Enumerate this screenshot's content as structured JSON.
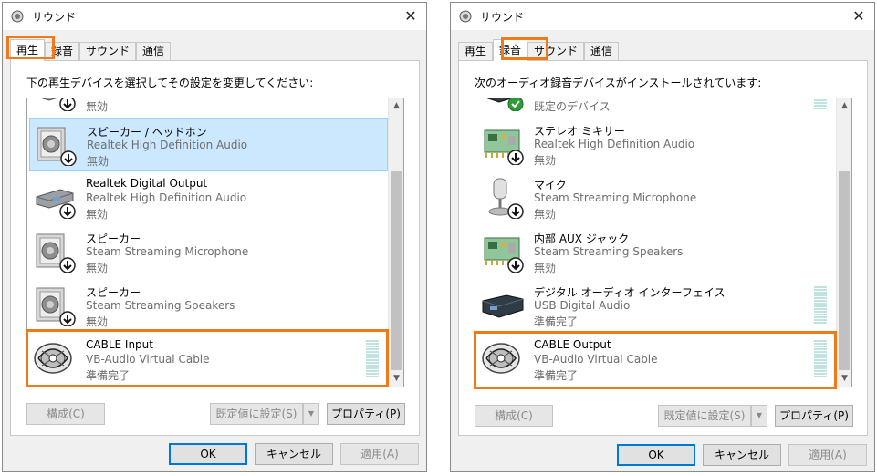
{
  "left": {
    "title": "サウンド",
    "tabs": [
      {
        "label": "再生"
      },
      {
        "label": "録音"
      },
      {
        "label": "サウンド"
      },
      {
        "label": "通信"
      }
    ],
    "instruction": "下の再生デバイスを選択してその設定を変更してください:",
    "devices": [
      {
        "status": "無効"
      },
      {
        "name": "スピーカー / ヘッドホン",
        "desc": "Realtek High Definition Audio",
        "status": "無効"
      },
      {
        "name": "Realtek Digital Output",
        "desc": "Realtek High Definition Audio",
        "status": "無効"
      },
      {
        "name": "スピーカー",
        "desc": "Steam Streaming Microphone",
        "status": "無効"
      },
      {
        "name": "スピーカー",
        "desc": "Steam Streaming Speakers",
        "status": "無効"
      },
      {
        "name": "CABLE Input",
        "desc": "VB-Audio Virtual Cable",
        "status": "準備完了"
      }
    ],
    "buttons": {
      "configure": "構成(C)",
      "set_default": "既定値に設定(S)",
      "properties": "プロパティ(P)",
      "ok": "OK",
      "cancel": "キャンセル",
      "apply": "適用(A)"
    }
  },
  "right": {
    "title": "サウンド",
    "tabs": [
      {
        "label": "再生"
      },
      {
        "label": "録音"
      },
      {
        "label": "サウンド"
      },
      {
        "label": "通信"
      }
    ],
    "instruction": "次のオーディオ録音デバイスがインストールされています:",
    "devices": [
      {
        "status": "既定のデバイス"
      },
      {
        "name": "ステレオ ミキサー",
        "desc": "Realtek High Definition Audio",
        "status": "無効"
      },
      {
        "name": "マイク",
        "desc": "Steam Streaming Microphone",
        "status": "無効"
      },
      {
        "name": "内部 AUX ジャック",
        "desc": "Steam Streaming Speakers",
        "status": "無効"
      },
      {
        "name": "デジタル オーディオ インターフェイス",
        "desc": "USB Digital Audio",
        "status": "準備完了"
      },
      {
        "name": "CABLE Output",
        "desc": "VB-Audio Virtual Cable",
        "status": "準備完了"
      }
    ],
    "buttons": {
      "configure": "構成(C)",
      "set_default": "既定値に設定(S)",
      "properties": "プロパティ(P)",
      "ok": "OK",
      "cancel": "キャンセル",
      "apply": "適用(A)"
    }
  },
  "colors": {
    "highlight": "#f07a1a",
    "selection": "#cce8ff",
    "focus": "#0078d7"
  }
}
